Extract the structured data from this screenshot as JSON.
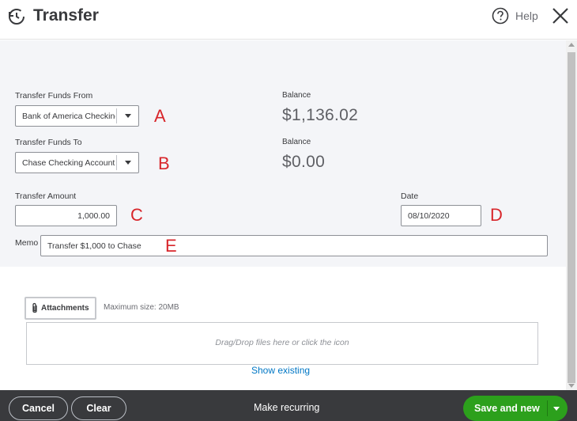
{
  "header": {
    "title": "Transfer",
    "help_label": "Help",
    "icons": {
      "history": "history-icon",
      "help": "help-circle-icon",
      "close": "close-icon"
    }
  },
  "form": {
    "from": {
      "label": "Transfer Funds From",
      "value": "Bank of America Checking",
      "balance_label": "Balance",
      "balance": "$1,136.02",
      "annotation": "A"
    },
    "to": {
      "label": "Transfer Funds To",
      "value": "Chase Checking Account",
      "balance_label": "Balance",
      "balance": "$0.00",
      "annotation": "B"
    },
    "amount": {
      "label": "Transfer Amount",
      "value": "1,000.00",
      "annotation": "C"
    },
    "date": {
      "label": "Date",
      "value": "08/10/2020",
      "annotation": "D"
    },
    "memo": {
      "label": "Memo",
      "value": "Transfer $1,000 to Chase",
      "annotation": "E"
    }
  },
  "attachments": {
    "button_label": "Attachments",
    "max_size": "Maximum size: 20MB",
    "dropzone_text": "Drag/Drop files here or click the icon",
    "show_existing": "Show existing",
    "icon": "paperclip-icon"
  },
  "footer": {
    "cancel": "Cancel",
    "clear": "Clear",
    "make_recurring": "Make recurring",
    "save_and_new": "Save and new"
  },
  "colors": {
    "accent_green": "#2ca01c",
    "footer_bg": "#393a3d",
    "link_blue": "#0077c5",
    "annotation_red": "#d8262b",
    "form_bg": "#f4f5f8"
  }
}
